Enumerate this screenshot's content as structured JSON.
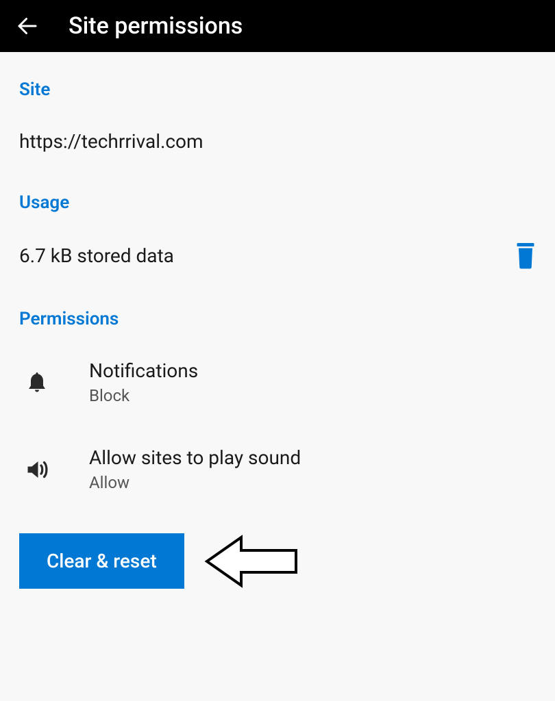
{
  "header": {
    "title": "Site permissions"
  },
  "sections": {
    "site": {
      "label": "Site",
      "url": "https://techrrival.com"
    },
    "usage": {
      "label": "Usage",
      "stored": "6.7 kB stored data"
    },
    "permissions": {
      "label": "Permissions",
      "items": [
        {
          "title": "Notifications",
          "value": "Block"
        },
        {
          "title": "Allow sites to play sound",
          "value": "Allow"
        }
      ]
    }
  },
  "actions": {
    "clearReset": "Clear & reset"
  }
}
